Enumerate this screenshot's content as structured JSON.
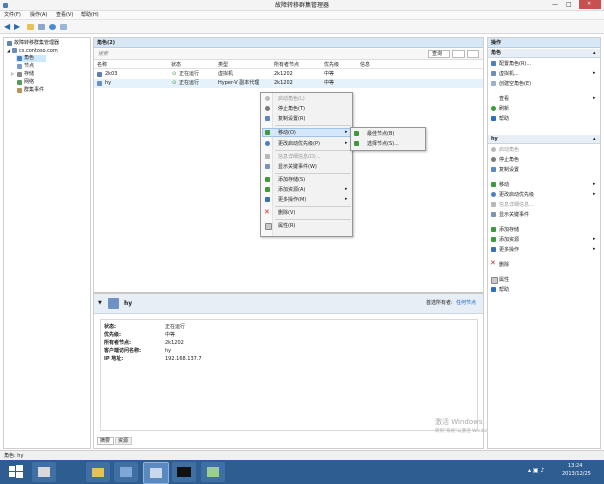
{
  "window": {
    "title": "故障转移群集管理器",
    "controls": [
      "—",
      "□",
      "✕"
    ]
  },
  "menubar": [
    "文件(F)",
    "操作(A)",
    "查看(V)",
    "帮助(H)"
  ],
  "tree": {
    "root": "故障转移群集管理器",
    "cluster": "cs.contoso.com",
    "items": [
      "角色",
      "节点",
      "存储",
      "网络",
      "群集事件"
    ]
  },
  "roles": {
    "header": "角色(2)",
    "search_placeholder": "搜索",
    "query_label": "查询",
    "columns": [
      "名称",
      "状态",
      "类型",
      "所有者节点",
      "优先级",
      "信息"
    ],
    "rows": [
      {
        "name": "2k03",
        "status": "正在运行",
        "type": "虚拟机",
        "owner": "2k1202",
        "priority": "中等",
        "info": ""
      },
      {
        "name": "hy",
        "status": "正在运行",
        "type": "Hyper-V 副本代理",
        "owner": "2k1202",
        "priority": "中等",
        "info": ""
      }
    ]
  },
  "context_menu": {
    "items": [
      {
        "label": "启动角色(L)",
        "disabled": true
      },
      {
        "label": "停止角色(T)",
        "disabled": false
      },
      {
        "label": "复制设置(R)",
        "disabled": false
      },
      {
        "label": "移动(O)",
        "disabled": false,
        "submenu": true
      },
      {
        "label": "更改启动优先级(P)",
        "disabled": false,
        "submenu": true
      },
      {
        "label": "信息详细信息(D)...",
        "disabled": true
      },
      {
        "label": "显示关键事件(W)",
        "disabled": false
      },
      {
        "label": "添加存储(S)",
        "disabled": false
      },
      {
        "label": "添加资源(A)",
        "disabled": false,
        "submenu": true
      },
      {
        "label": "更多操作(M)",
        "disabled": false,
        "submenu": true
      },
      {
        "label": "删除(V)",
        "disabled": false
      },
      {
        "label": "属性(R)",
        "disabled": false
      }
    ],
    "submenu": [
      "最佳节点(B)",
      "选择节点(S)..."
    ]
  },
  "details": {
    "name": "hy",
    "preferred_owners_label": "首选所有者:",
    "any_node_link": "任何节点",
    "fields": [
      {
        "label": "状态:",
        "value": "正在运行"
      },
      {
        "label": "优先级:",
        "value": "中等"
      },
      {
        "label": "所有者节点:",
        "value": "2k1202"
      },
      {
        "label": "客户端访问名称:",
        "value": "hy"
      },
      {
        "label": "IP 地址:",
        "value": "192.168.137.7"
      }
    ],
    "tabs": [
      "摘要",
      "资源"
    ]
  },
  "actions": {
    "title": "操作",
    "section1": "角色",
    "section1_items": [
      "配置角色(R)...",
      "虚拟机...",
      "创建空角色(E)",
      "查看",
      "刷新",
      "帮助"
    ],
    "section2": "hy",
    "section2_items": [
      "启动角色",
      "停止角色",
      "复制设置",
      "移动",
      "更改启动优先级",
      "信息详细信息...",
      "显示关键事件",
      "添加存储",
      "添加资源",
      "更多操作",
      "删除",
      "属性",
      "帮助"
    ]
  },
  "watermark": {
    "line1": "激活 Windows",
    "line2": "转到\"系统\"以激活 Windows。"
  },
  "statusbar": "角色: hy",
  "clock": {
    "time": "13:24",
    "date": "2013/12/25"
  },
  "colors": {
    "header": "#d7e7f6",
    "taskbar": "#2e5d91",
    "selection": "#cde8ff",
    "link": "#1565c0"
  }
}
